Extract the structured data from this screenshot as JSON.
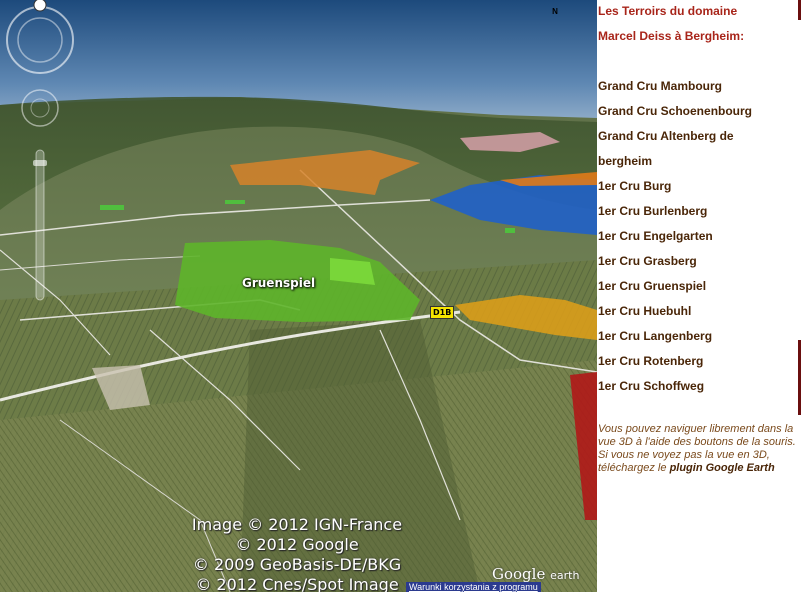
{
  "sidebar": {
    "title_line1": "Les Terroirs du domaine",
    "title_line2": "Marcel Deiss à Bergheim:",
    "crus": [
      "Grand Cru Mambourg",
      "Grand Cru Schoenenbourg",
      "Grand Cru Altenberg de",
      "bergheim",
      "1er Cru Burg",
      "1er Cru Burlenberg",
      "1er Cru Engelgarten",
      "1er Cru Grasberg",
      "1er Cru Gruenspiel",
      "1er Cru Huebuhl",
      "1er Cru Langenberg",
      "1er Cru Rotenberg",
      "1er Cru Schoffweg"
    ],
    "note": {
      "line1": "Vous pouvez naviguer librement dans la vue 3D à l'aide des boutons de la souris.",
      "line2": "Si vous ne voyez pas la vue en 3D, téléchargez le",
      "plugin_label": "plugin Google Earth"
    }
  },
  "map": {
    "place_label": "Gruenspiel",
    "road_label": "D1B",
    "compass_label": "N",
    "copyright": [
      "Image © 2012 IGN-France",
      "© 2012 Google",
      "© 2009 GeoBasis-DE/BKG",
      "© 2012 Cnes/Spot Image"
    ],
    "brand_google": "Google",
    "brand_earth": "earth",
    "terms_link": "Warunki korzystania z programu"
  }
}
